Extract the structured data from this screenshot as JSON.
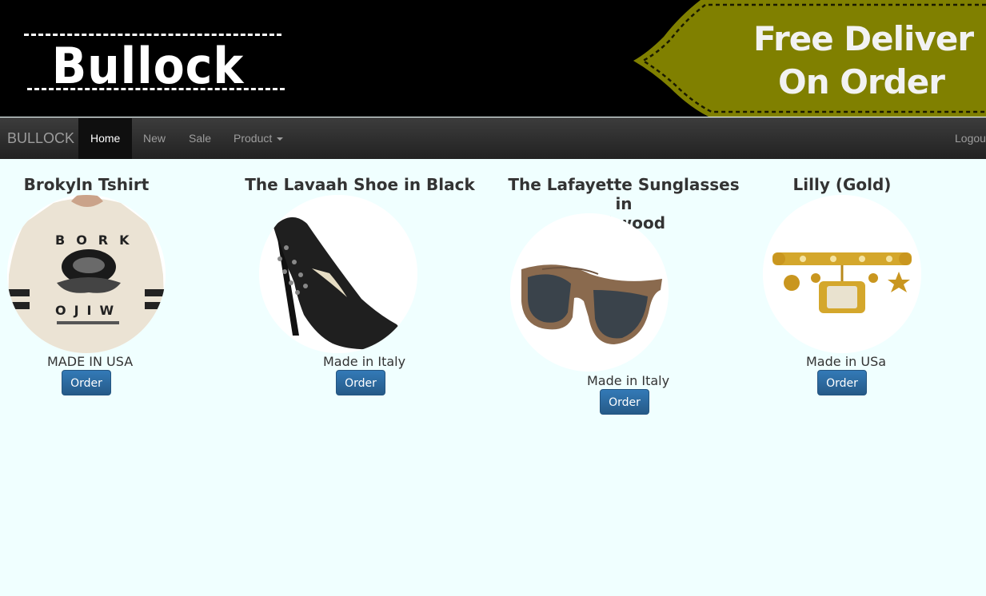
{
  "banner": {
    "logo": "Bullock",
    "promo_line1": "Free Deliver",
    "promo_line2": "On Order"
  },
  "colors": {
    "promo_bg": "#808000",
    "page_bg": "#f0ffff",
    "button": "#337ab7"
  },
  "navbar": {
    "brand": "BULLOCK",
    "items": [
      {
        "label": "Home"
      },
      {
        "label": "New"
      },
      {
        "label": "Sale"
      },
      {
        "label": "Product"
      }
    ],
    "logout": "Logout"
  },
  "products": [
    {
      "title": "Brokyln Tshirt",
      "origin": "MADE IN USA",
      "button": "Order",
      "image": "tshirt-image"
    },
    {
      "title": "The Lavaah Shoe in Black",
      "origin": "Made in Italy",
      "button": "Order",
      "image": "shoe-image"
    },
    {
      "title_line1": "The Lafayette Sunglasses in",
      "title_line2": "Oakwood",
      "origin": "Made in Italy",
      "button": "Order",
      "image": "sunglasses-image"
    },
    {
      "title": "Lilly (Gold)",
      "origin": "Made in USa",
      "button": "Order",
      "image": "watch-image"
    }
  ]
}
